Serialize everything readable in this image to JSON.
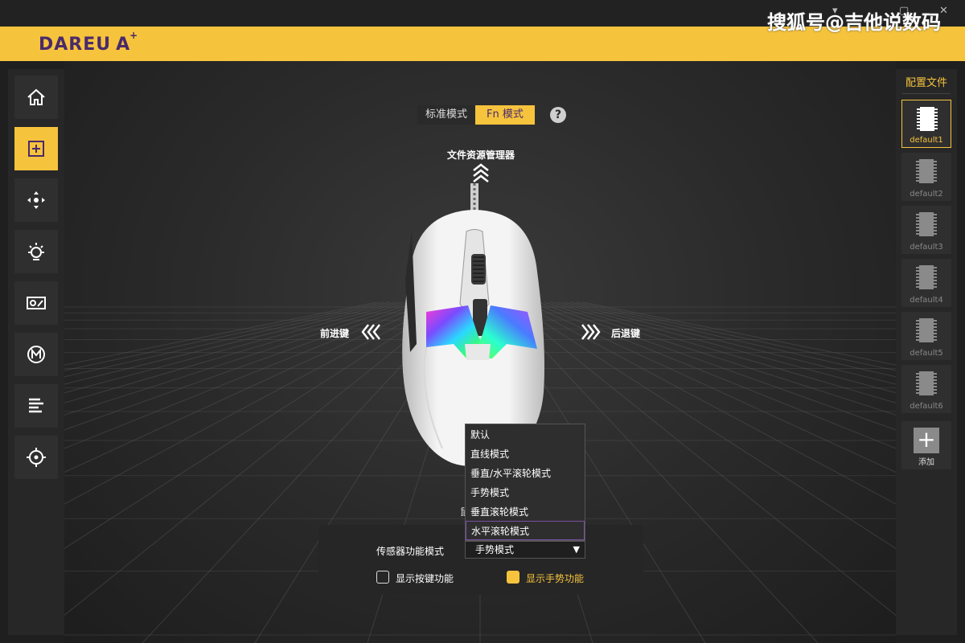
{
  "watermark": "搜狐号@吉他说数码",
  "brand": {
    "name": "DAREU",
    "suffix": "A",
    "suffix_mark": "+"
  },
  "sidebar": {
    "items": [
      {
        "icon": "home-icon",
        "active": false
      },
      {
        "icon": "key-assign-icon",
        "active": true
      },
      {
        "icon": "dpi-move-icon",
        "active": false
      },
      {
        "icon": "lighting-icon",
        "active": false
      },
      {
        "icon": "performance-icon",
        "active": false
      },
      {
        "icon": "macro-icon",
        "active": false
      },
      {
        "icon": "list-icon",
        "active": false
      },
      {
        "icon": "calibration-icon",
        "active": false
      }
    ]
  },
  "profiles": {
    "header": "配置文件",
    "items": [
      {
        "label": "default1",
        "active": true
      },
      {
        "label": "default2",
        "active": false
      },
      {
        "label": "default3",
        "active": false
      },
      {
        "label": "default4",
        "active": false
      },
      {
        "label": "default5",
        "active": false
      },
      {
        "label": "default6",
        "active": false
      }
    ],
    "add_label": "添加"
  },
  "mode_toggle": {
    "standard": "标准模式",
    "fn": "Fn 模式",
    "help": "?"
  },
  "gestures": {
    "up": "文件资源管理器",
    "left": "前进键",
    "right": "后退键"
  },
  "dropdown": {
    "options": [
      "默认",
      "直线模式",
      "垂直/水平滚轮模式",
      "手势模式",
      "垂直滚轮模式",
      "水平滚轮模式"
    ],
    "hover_index": 5
  },
  "settings": {
    "sensor_label": "传感器功能模式",
    "sensor_value": "手势模式",
    "show_keys_label": "显示按键功能",
    "show_keys_checked": false,
    "show_gesture_label": "显示手势功能",
    "show_gesture_checked": true,
    "hidden_fragment": "鼠"
  },
  "colors": {
    "accent": "#f6c33d",
    "brand_purple": "#4a2a6a",
    "background": "#1f1f1f"
  }
}
